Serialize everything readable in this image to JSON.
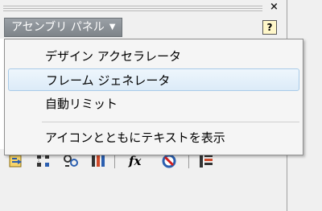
{
  "panel": {
    "title": "アセンブリ パネル",
    "close_glyph": "×",
    "help_glyph": "?"
  },
  "menu": {
    "items": [
      {
        "label": "デザイン アクセラレータ",
        "highlighted": false
      },
      {
        "label": "フレーム ジェネレータ",
        "highlighted": true
      },
      {
        "label": "自動リミット",
        "highlighted": false
      },
      {
        "label": "アイコンとともにテキストを表示",
        "highlighted": false
      }
    ]
  },
  "toolbar": {
    "icons": [
      "component-icon",
      "pattern-icon",
      "constraint-icon",
      "joint-icon",
      "fx-icon",
      "no-symbol-icon",
      "bom-icon"
    ],
    "fx_label": "fx"
  },
  "colors": {
    "title_bg": "#8a9096",
    "highlight": "#dcebf8"
  }
}
